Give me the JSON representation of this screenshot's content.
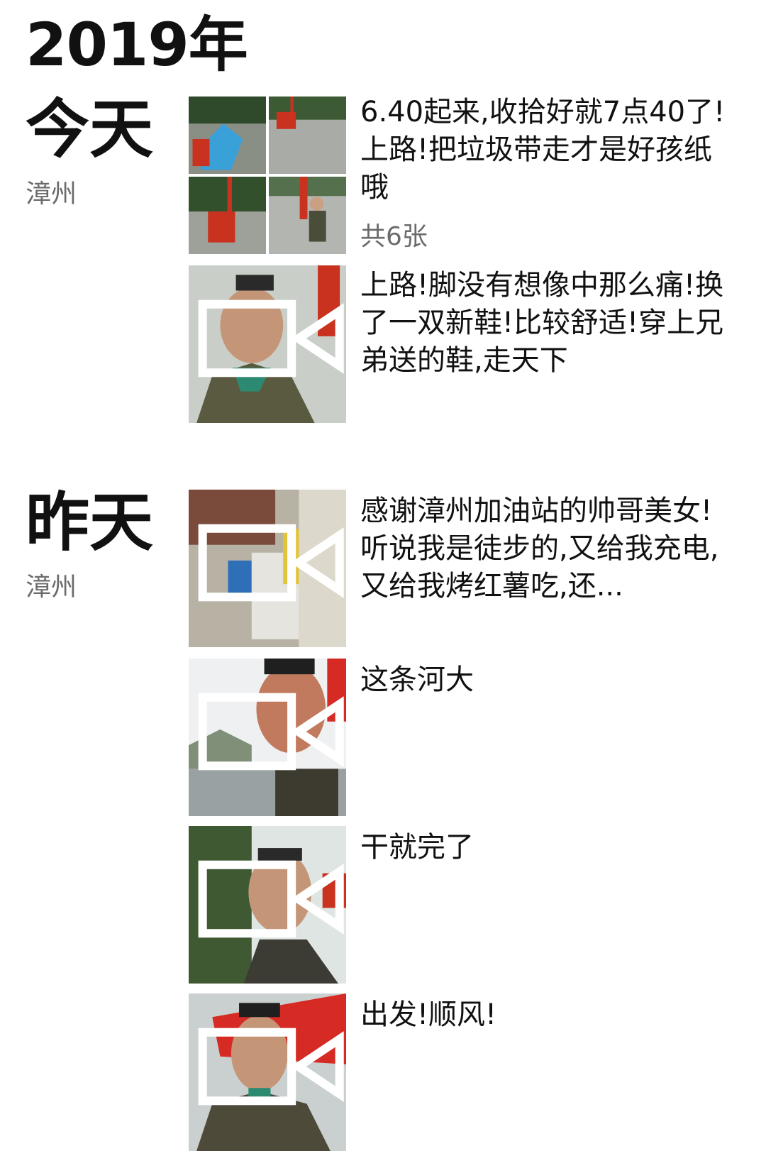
{
  "year": "2019年",
  "groups": [
    {
      "day": "今天",
      "location": "漳州",
      "posts": [
        {
          "text": "6.40起来,收拾好就7点40了!上路!把垃圾带走才是好孩纸哦",
          "image_count": "共6张",
          "media": "photo-grid"
        },
        {
          "text": "上路!脚没有想像中那么痛!换了一双新鞋!比较舒适!穿上兄弟送的鞋,走天下",
          "media": "video"
        }
      ]
    },
    {
      "day": "昨天",
      "location": "漳州",
      "posts": [
        {
          "text": "感谢漳州加油站的帅哥美女!听说我是徒步的,又给我充电,又给我烤红薯吃,还...",
          "media": "video"
        },
        {
          "text": "这条河大",
          "media": "video"
        },
        {
          "text": "干就完了",
          "media": "video"
        },
        {
          "text": "出发!顺风!",
          "media": "video"
        }
      ]
    }
  ],
  "icons": {
    "video": "video-camera-icon"
  },
  "colors": {
    "text": "#111111",
    "secondary": "#6b6b6b",
    "background": "#ffffff"
  }
}
